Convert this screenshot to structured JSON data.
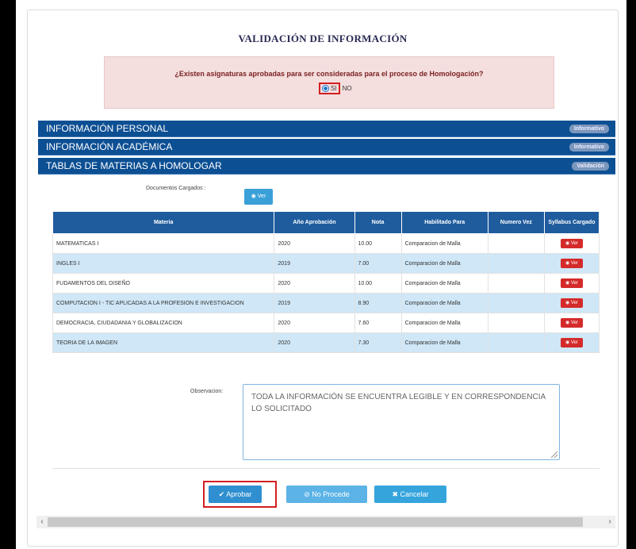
{
  "header": {
    "title": "VALIDACIÓN DE INFORMACIÓN"
  },
  "question": {
    "text": "¿Existen asignaturas aprobadas para ser consideradas para el proceso de Homologación?",
    "option_yes": "SI",
    "option_no": "NO"
  },
  "sections": [
    {
      "label": "INFORMACIÓN PERSONAL",
      "badge": "Informativo"
    },
    {
      "label": "INFORMACIÓN ACADÉMICA",
      "badge": "Informativo"
    },
    {
      "label": "TABLAS DE MATERIAS A HOMOLOGAR",
      "badge": "Validación"
    }
  ],
  "documents": {
    "label": "Documentos Cargados :",
    "button": "Ver"
  },
  "table": {
    "headers": [
      "Materia",
      "Año Aprobación",
      "Nota",
      "Habilitado Para",
      "Numero Vez",
      "Syllabus Cargado"
    ],
    "view_button": "Ver",
    "rows": [
      {
        "materia": "MATEMATICAS I",
        "anio": "2020",
        "nota": "10.00",
        "habilitado": "Comparacion de Malla",
        "vez": ""
      },
      {
        "materia": "INGLES I",
        "anio": "2019",
        "nota": "7.00",
        "habilitado": "Comparacion de Malla",
        "vez": ""
      },
      {
        "materia": "FUDAMENTOS DEL DISEÑO",
        "anio": "2020",
        "nota": "10.00",
        "habilitado": "Comparacion de Malla",
        "vez": ""
      },
      {
        "materia": "COMPUTACION I - TIC APLICADAS A LA PROFESION E INVESTIGACION",
        "anio": "2019",
        "nota": "8.90",
        "habilitado": "Comparacion de Malla",
        "vez": ""
      },
      {
        "materia": "DEMOCRACIA, CIUDADANIA Y GLOBALIZACION",
        "anio": "2020",
        "nota": "7.60",
        "habilitado": "Comparacion de Malla",
        "vez": ""
      },
      {
        "materia": "TEORIA DE LA IMAGEN",
        "anio": "2020",
        "nota": "7.30",
        "habilitado": "Comparacion de Malla",
        "vez": ""
      }
    ]
  },
  "observation": {
    "label": "Observacion:",
    "value": "TODA LA INFORMACIÓN SE ENCUENTRA LEGIBLE Y EN CORRESPONDENCIA LO SOLICITADO"
  },
  "actions": {
    "approve": "Aprobar",
    "no_procede": "No Procede",
    "cancel": "Cancelar"
  },
  "colors": {
    "section_bar": "#0d4f93",
    "table_header": "#1f5c9e",
    "row_alt": "#cfe7f7",
    "highlight": "#d31f1f"
  }
}
